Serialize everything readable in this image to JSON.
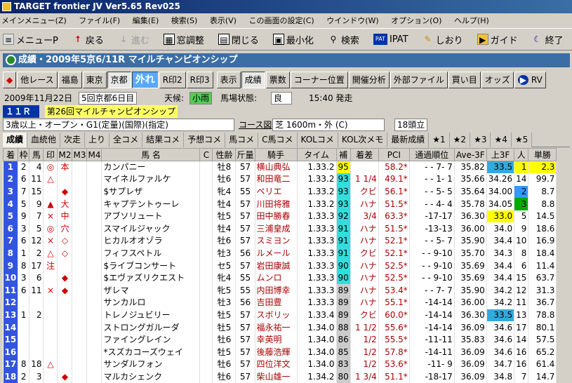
{
  "app": {
    "title": "TARGET frontier JV  Ver5.65  Rev025"
  },
  "menu": [
    "メインメニュー(Z)",
    "ファイル(F)",
    "編集(E)",
    "検索(S)",
    "表示(V)",
    "この画面の設定(C)",
    "ウインドウ(W)",
    "オプション(O)",
    "ヘルプ(H)"
  ],
  "toolbar": {
    "menu_p": "メニューP",
    "back": "戻る",
    "forward": "進む",
    "window_adjust": "窓調整",
    "close": "閉じる",
    "minimize": "最小化",
    "search": "検索",
    "ipat": "IPAT",
    "bookmark": "しおり",
    "guide": "ガイド",
    "exit": "終了"
  },
  "header": {
    "title": "成績・2009年5京6/11R マイルチャンピオンシップ"
  },
  "nav": {
    "other_race": "他レース",
    "fukushima": "福島",
    "tokyo": "東京",
    "kyoto": "京都",
    "hazure": "外れ",
    "r_prev2": "R印2",
    "r_prev3": "R印3",
    "display": "表示",
    "results": "成績",
    "votes": "票数",
    "corner": "コーナー位置",
    "pace": "開催分析",
    "ext_file": "外部ファイル",
    "buy": "買い目",
    "odds": "オッズ",
    "rv": "RV"
  },
  "race": {
    "date": "2009年11月22日",
    "kai": "5回京都6日目",
    "weather_label": "天候:",
    "weather": "小雨",
    "track_label": "馬場状態:",
    "track": "良",
    "start": "15:40 発走",
    "race_no": "１１Ｒ",
    "name": "第26回マイルチャンピオンシップ",
    "cond": "3歳以上・オープン・G1(定量)(国際)(指定)",
    "course_label": "コース図",
    "course": "芝 1600m・外 (C)",
    "heads": "18頭立"
  },
  "tabs": [
    "成績",
    "血統他",
    "次走",
    "上り",
    "全コメ",
    "結果コメ",
    "予想コメ",
    "馬コメ",
    "C馬コメ",
    "KOLコメ",
    "KOL次メモ",
    "最新成績",
    "★1",
    "★2",
    "★3",
    "★4",
    "★5"
  ],
  "columns": [
    "着",
    "枠",
    "馬",
    "印",
    "M2",
    "M3",
    "M4",
    "馬 名",
    "C",
    "性齢",
    "斤量",
    "騎手",
    "タイム",
    "補",
    "着差",
    "PCI",
    "通過順位",
    "Ave-3F",
    "上3F",
    "人",
    "単勝"
  ],
  "rows": [
    {
      "chaku": "1",
      "waku": "2",
      "uma": "4",
      "mark": "◎",
      "m2": "本",
      "m3": "",
      "m4": "",
      "name": "カンパニー",
      "c": "",
      "sei": "牡8",
      "kin": "57",
      "jockey": "横山典弘",
      "time": "1.33.2",
      "ho": "95",
      "sa": "",
      "pci": "58.2*",
      "tsuka": "- - 7- 7",
      "ave": "35.82",
      "agari": "33.5",
      "nin": "1",
      "tan": "2.3"
    },
    {
      "chaku": "2",
      "waku": "6",
      "uma": "11",
      "mark": "△",
      "m2": "",
      "m3": "",
      "m4": "",
      "name": "マイネルファルケ",
      "c": "",
      "sei": "牡6",
      "kin": "57",
      "jockey": "和田竜二",
      "time": "1.33.2",
      "ho": "93",
      "sa": "1 1/4",
      "pci": "49.1*",
      "tsuka": "- - 1- 1",
      "ave": "35.66",
      "agari": "34.26",
      "nin": "14",
      "tan": "99.7"
    },
    {
      "chaku": "3",
      "waku": "7",
      "uma": "15",
      "mark": "",
      "m2": "◆",
      "m3": "",
      "m4": "",
      "name": "$サプレザ",
      "c": "",
      "sei": "牝4",
      "kin": "55",
      "jockey": "ペリエ",
      "time": "1.33.2",
      "ho": "93",
      "sa": "クビ",
      "pci": "56.1*",
      "tsuka": "- - 5- 5",
      "ave": "35.64",
      "agari": "34.00",
      "nin": "2",
      "tan": "8.7"
    },
    {
      "chaku": "4",
      "waku": "5",
      "uma": "9",
      "mark": "▲",
      "m2": "大",
      "m3": "",
      "m4": "",
      "name": "キャプテントゥーレ",
      "c": "",
      "sei": "牡4",
      "kin": "57",
      "jockey": "川田将雅",
      "time": "1.33.2",
      "ho": "93",
      "sa": "ハナ",
      "pci": "51.5*",
      "tsuka": "- - 4- 4",
      "ave": "35.78",
      "agari": "34.05",
      "nin": "3",
      "tan": "8.8"
    },
    {
      "chaku": "5",
      "waku": "9",
      "uma": "7",
      "mark": "×",
      "m2": "中",
      "m3": "",
      "m4": "",
      "name": "アブソリュート",
      "c": "",
      "sei": "牡5",
      "kin": "57",
      "jockey": "田中勝春",
      "time": "1.33.3",
      "ho": "92",
      "sa": "3/4",
      "pci": "63.3*",
      "tsuka": "-17-17",
      "ave": "36.30",
      "agari": "33.0",
      "nin": "5",
      "tan": "14.5"
    },
    {
      "chaku": "6",
      "waku": "3",
      "uma": "5",
      "mark": "◎",
      "m2": "穴",
      "m3": "",
      "m4": "",
      "name": "スマイルジャック",
      "c": "",
      "sei": "牡4",
      "kin": "57",
      "jockey": "三浦皇成",
      "time": "1.33.3",
      "ho": "91",
      "sa": "ハナ",
      "pci": "51.5*",
      "tsuka": "-13-13",
      "ave": "36.00",
      "agari": "34.0",
      "nin": "9",
      "tan": "18.6"
    },
    {
      "chaku": "7",
      "waku": "6",
      "uma": "12",
      "mark": "×",
      "m2": "◇",
      "m3": "",
      "m4": "",
      "name": "ヒカルオオゾラ",
      "c": "",
      "sei": "牡6",
      "kin": "57",
      "jockey": "スミヨン",
      "time": "1.33.3",
      "ho": "91",
      "sa": "ハナ",
      "pci": "52.1*",
      "tsuka": "- - 5- 7",
      "ave": "35.90",
      "agari": "34.4",
      "nin": "10",
      "tan": "16.9"
    },
    {
      "chaku": "8",
      "waku": "1",
      "uma": "2",
      "mark": "△",
      "m2": "◇",
      "m3": "",
      "m4": "",
      "name": "フィフスペトル",
      "c": "",
      "sei": "牡3",
      "kin": "56",
      "jockey": "ルメール",
      "time": "1.33.3",
      "ho": "91",
      "sa": "クビ",
      "pci": "52.1*",
      "tsuka": "- - 9-10",
      "ave": "35.70",
      "agari": "34.3",
      "nin": "8",
      "tan": "18.4"
    },
    {
      "chaku": "9",
      "waku": "8",
      "uma": "17",
      "mark": "注",
      "m2": "",
      "m3": "",
      "m4": "",
      "name": "$ライブコンサート",
      "c": "",
      "sei": "セ5",
      "kin": "57",
      "jockey": "岩田康誠",
      "time": "1.33.3",
      "ho": "90",
      "sa": "ハナ",
      "pci": "52.5*",
      "tsuka": "- - 9-10",
      "ave": "35.69",
      "agari": "34.4",
      "nin": "6",
      "tan": "11.4"
    },
    {
      "chaku": "10",
      "waku": "3",
      "uma": "6",
      "mark": "",
      "m2": "◆",
      "m3": "",
      "m4": "",
      "name": "$エヴァズリクエスト",
      "c": "",
      "sei": "牝4",
      "kin": "55",
      "jockey": "ムンロ",
      "time": "1.33.3",
      "ho": "90",
      "sa": "ハナ",
      "pci": "52.5*",
      "tsuka": "- - 9-10",
      "ave": "35.69",
      "agari": "34.4",
      "nin": "15",
      "tan": "63.7"
    },
    {
      "chaku": "11",
      "waku": "6",
      "uma": "11",
      "mark": "×",
      "m2": "◆",
      "m3": "",
      "m4": "",
      "name": "ザレマ",
      "c": "",
      "sei": "牝5",
      "kin": "55",
      "jockey": "内田博幸",
      "time": "1.33.3",
      "ho": "89",
      "sa": "ハナ",
      "pci": "53.4*",
      "tsuka": "- - 7- 7",
      "ave": "35.90",
      "agari": "34.2",
      "nin": "12",
      "tan": "31.3"
    },
    {
      "chaku": "12",
      "waku": "",
      "uma": "",
      "mark": "",
      "m2": "",
      "m3": "",
      "m4": "",
      "name": "サンカルロ",
      "c": "",
      "sei": "牡3",
      "kin": "56",
      "jockey": "吉田豊",
      "time": "1.33.3",
      "ho": "89",
      "sa": "ハナ",
      "pci": "55.1*",
      "tsuka": "-14-14",
      "ave": "36.00",
      "agari": "34.2",
      "nin": "11",
      "tan": "36.7"
    },
    {
      "chaku": "13",
      "waku": "1",
      "uma": "2",
      "mark": "",
      "m2": "",
      "m3": "",
      "m4": "",
      "name": "トレノジュビリー",
      "c": "",
      "sei": "牡5",
      "kin": "57",
      "jockey": "スボリッ",
      "time": "1.33.4",
      "ho": "89",
      "sa": "クビ",
      "pci": "60.0*",
      "tsuka": "-14-14",
      "ave": "36.30",
      "agari": "33.5",
      "nin": "13",
      "tan": "78.8"
    },
    {
      "chaku": "14",
      "waku": "",
      "uma": "",
      "mark": "",
      "m2": "",
      "m3": "",
      "m4": "",
      "name": "ストロングガルーダ",
      "c": "",
      "sei": "牡5",
      "kin": "57",
      "jockey": "福永祐一",
      "time": "1.34.0",
      "ho": "88",
      "sa": "1 1/2",
      "pci": "55.6*",
      "tsuka": "-14-14",
      "ave": "36.09",
      "agari": "34.6",
      "nin": "17",
      "tan": "80.1"
    },
    {
      "chaku": "15",
      "waku": "",
      "uma": "",
      "mark": "",
      "m2": "",
      "m3": "",
      "m4": "",
      "name": "ファイングレイン",
      "c": "",
      "sei": "牡6",
      "kin": "57",
      "jockey": "幸英明",
      "time": "1.34.0",
      "ho": "86",
      "sa": "1/2",
      "pci": "55.5*",
      "tsuka": "-11-11",
      "ave": "35.83",
      "agari": "34.6",
      "nin": "14",
      "tan": "57.5"
    },
    {
      "chaku": "16",
      "waku": "",
      "uma": "",
      "mark": "",
      "m2": "",
      "m3": "",
      "m4": "",
      "name": "*スズカコーズウェイ",
      "c": "",
      "sei": "牡5",
      "kin": "57",
      "jockey": "後藤浩輝",
      "time": "1.34.0",
      "ho": "85",
      "sa": "1/2",
      "pci": "57.8*",
      "tsuka": "-14-11",
      "ave": "36.09",
      "agari": "34.6",
      "nin": "16",
      "tan": "65.2"
    },
    {
      "chaku": "17",
      "waku": "8",
      "uma": "18",
      "mark": "△",
      "m2": "",
      "m3": "",
      "m4": "",
      "name": "サンダルフォン",
      "c": "",
      "sei": "牡6",
      "kin": "57",
      "jockey": "四位洋文",
      "time": "1.34.0",
      "ho": "83",
      "sa": "1/2",
      "pci": "53.6*",
      "tsuka": "-11- 9",
      "ave": "36.09",
      "agari": "34.7",
      "nin": "16",
      "tan": "61.4"
    },
    {
      "chaku": "18",
      "waku": "2",
      "uma": "3",
      "mark": "",
      "m2": "◆",
      "m3": "",
      "m4": "",
      "name": "マルカシェンク",
      "c": "",
      "sei": "牡6",
      "kin": "57",
      "jockey": "柴山雄一",
      "time": "1.34.2",
      "ho": "80",
      "sa": "1 3/4",
      "pci": "51.1*",
      "tsuka": "-18-17",
      "ave": "36.09",
      "agari": "34.8",
      "nin": "7",
      "tan": "14.7"
    }
  ],
  "colors": {
    "chaku_bg": "#3355dd",
    "ho_hi": "#ffff00",
    "ho_mid": "#33dddd",
    "agari_hi": "#33aadd",
    "agari_top": "#ffff00",
    "nin_top": "#ffff00",
    "nin_2_bg": "#3399ff",
    "waku_colors": [
      "#ffffff",
      "#000000",
      "#ff0000",
      "#0000ff",
      "#ffff00",
      "#00aa00",
      "#ff8800",
      "#ff66aa"
    ]
  }
}
